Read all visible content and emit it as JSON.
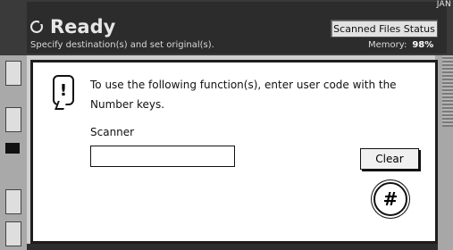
{
  "corner_label": "JAN",
  "status": {
    "title": "Ready",
    "instruction": "Specify destination(s) and set original(s).",
    "scanned_files_button": "Scanned Files Status",
    "memory_label": "Memory:",
    "memory_value": "98%"
  },
  "dialog": {
    "message": "To use the following function(s), enter user code with the Number keys.",
    "function_name": "Scanner",
    "user_code_value": "",
    "clear_label": "Clear",
    "hash_label": "#"
  },
  "icons": [
    "ready-icon",
    "alert-icon",
    "hash-key-icon"
  ]
}
